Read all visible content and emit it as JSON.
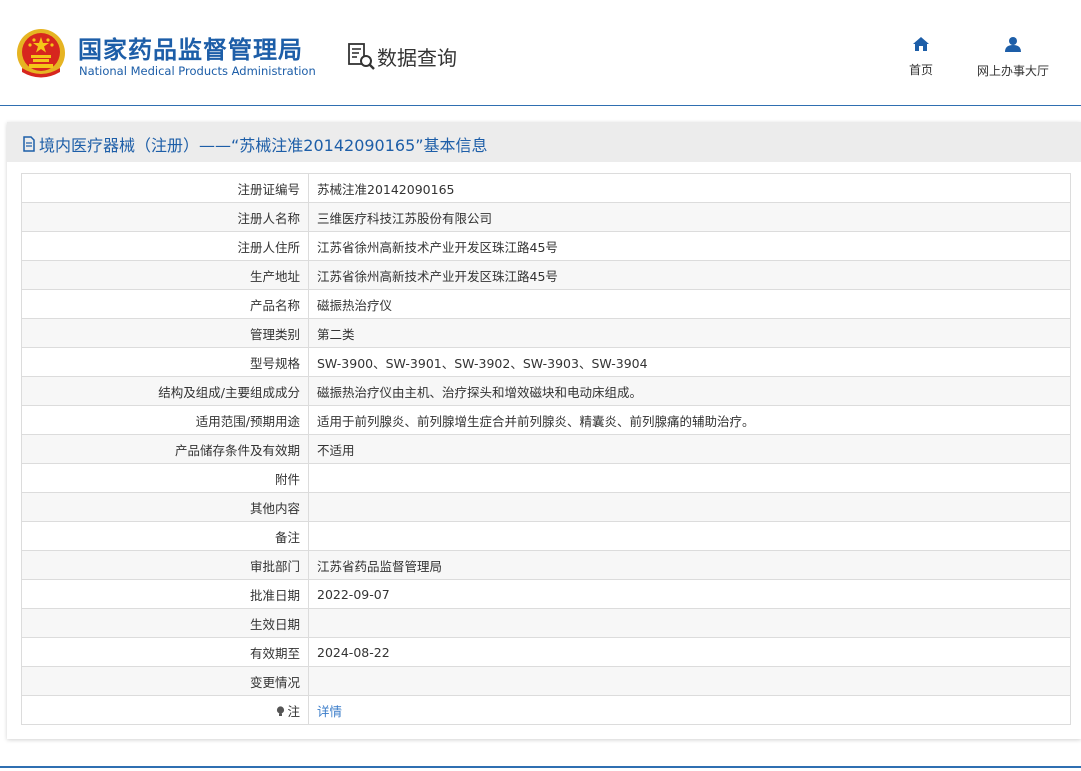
{
  "header": {
    "brand_cn": "国家药品监督管理局",
    "brand_en": "National Medical Products Administration",
    "query_label": "数据查询",
    "nav": [
      {
        "label": "首页",
        "icon": "home-icon"
      },
      {
        "label": "网上办事大厅",
        "icon": "user-icon"
      }
    ]
  },
  "page": {
    "title": "境内医疗器械（注册）——“苏械注准20142090165”基本信息"
  },
  "table": {
    "rows": [
      {
        "label": "注册证编号",
        "value": "苏械注准20142090165"
      },
      {
        "label": "注册人名称",
        "value": "三维医疗科技江苏股份有限公司"
      },
      {
        "label": "注册人住所",
        "value": "江苏省徐州高新技术产业开发区珠江路45号"
      },
      {
        "label": "生产地址",
        "value": "江苏省徐州高新技术产业开发区珠江路45号"
      },
      {
        "label": "产品名称",
        "value": "磁振热治疗仪"
      },
      {
        "label": "管理类别",
        "value": "第二类"
      },
      {
        "label": "型号规格",
        "value": "SW-3900、SW-3901、SW-3902、SW-3903、SW-3904"
      },
      {
        "label": "结构及组成/主要组成成分",
        "value": "磁振热治疗仪由主机、治疗探头和增效磁块和电动床组成。"
      },
      {
        "label": "适用范围/预期用途",
        "value": "适用于前列腺炎、前列腺增生症合并前列腺炎、精囊炎、前列腺痛的辅助治疗。"
      },
      {
        "label": "产品储存条件及有效期",
        "value": "不适用"
      },
      {
        "label": "附件",
        "value": ""
      },
      {
        "label": "其他内容",
        "value": ""
      },
      {
        "label": "备注",
        "value": ""
      },
      {
        "label": "审批部门",
        "value": "江苏省药品监督管理局"
      },
      {
        "label": "批准日期",
        "value": "2022-09-07"
      },
      {
        "label": "生效日期",
        "value": ""
      },
      {
        "label": "有效期至",
        "value": "2024-08-22"
      },
      {
        "label": "变更情况",
        "value": ""
      }
    ],
    "note_label": "注",
    "note_link": "详情"
  },
  "colors": {
    "brand": "#1d5ea8",
    "link": "#3a7cc9",
    "rule": "#2f6fb1"
  }
}
